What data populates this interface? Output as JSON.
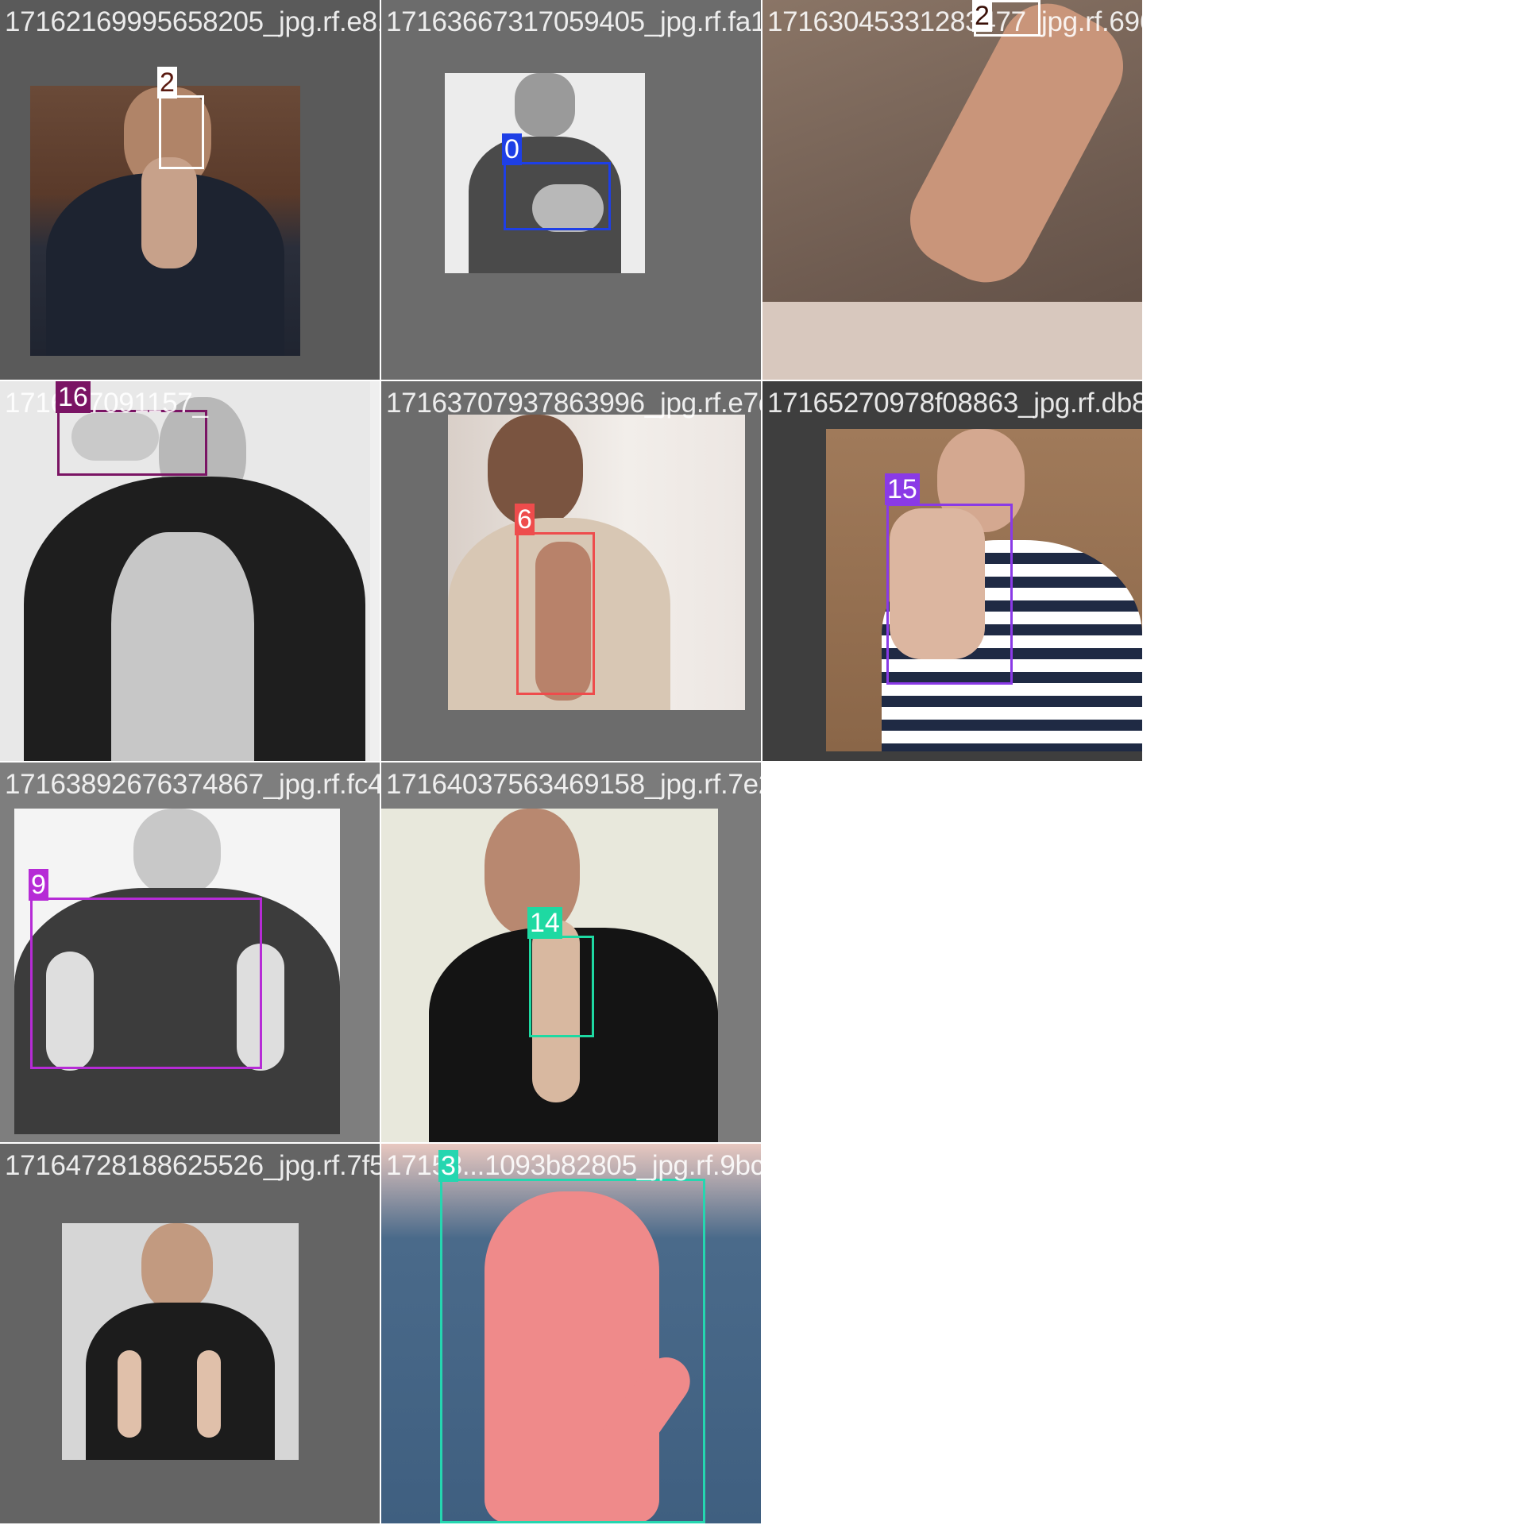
{
  "tiles": [
    {
      "filename": "17162169995658205_jpg.rf.e818a8678f3f70924",
      "label": "2",
      "box_color": "#ffffff",
      "label_text_color": "#5a1a10"
    },
    {
      "filename": "17163667317059405_jpg.rf.fa1fc0e43c12888",
      "label": "0",
      "box_color": "#1e3fe6",
      "label_text_color": "#ffffff"
    },
    {
      "filename": "17163045331283477_jpg.rf.696844bcc7997f0",
      "label": "2",
      "box_color": "#ffffff",
      "label_text_color": "#3a1008"
    },
    {
      "filename": "1716...7091157_",
      "label": "16",
      "box_color": "#7a1464",
      "label_text_color": "#ffffff"
    },
    {
      "filename": "17163707937863996_jpg.rf.e7dee5207924f082863",
      "label": "6",
      "box_color": "#ee4c4c",
      "label_text_color": "#ffffff"
    },
    {
      "filename": "17165270978f08863_jpg.rf.db809874db407d6",
      "label": "15",
      "box_color": "#8a3ae6",
      "label_text_color": "#ffffff"
    },
    {
      "filename": "17163892676374867_jpg.rf.fc412d4037634158",
      "label": "9",
      "box_color": "#b62bd6",
      "label_text_color": "#ffffff"
    },
    {
      "filename": "17164037563469158_jpg.rf.7e25312b320c7918",
      "label": "14",
      "box_color": "#1ed9a2",
      "label_text_color": "#ffffff"
    },
    {
      "filename": "17164728188625526_jpg.rf.7f58...",
      "label": "",
      "box_color": "",
      "label_text_color": ""
    },
    {
      "filename": "17158...1093b82805_jpg.rf.9bc0346ba8a2bba",
      "label": "3",
      "box_color": "#25d6b0",
      "label_text_color": "#ffffff"
    }
  ]
}
